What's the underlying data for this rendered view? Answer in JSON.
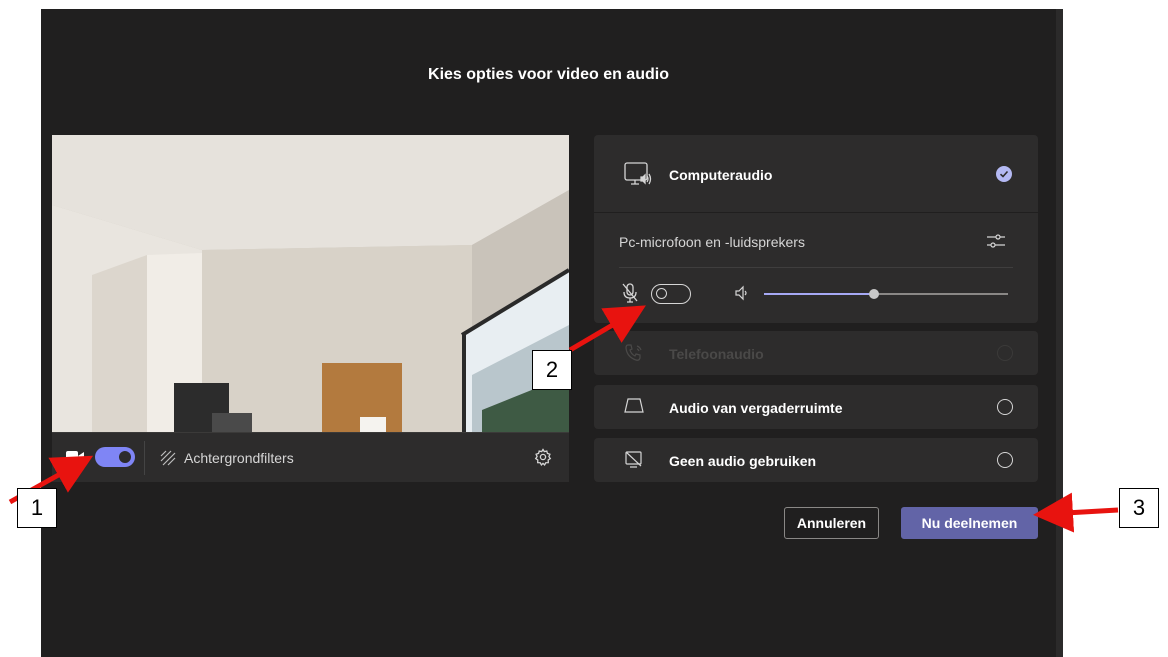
{
  "dialog": {
    "title": "Kies opties voor video en audio"
  },
  "video": {
    "camera_on": true,
    "background_filters_label": "Achtergrondfilters"
  },
  "audio": {
    "computer_audio": {
      "label": "Computeraudio",
      "selected": true,
      "device_label": "Pc-microfoon en -luidsprekers",
      "mic_on": false,
      "volume_fraction": 0.45
    },
    "options": [
      {
        "label": "Telefoonaudio",
        "disabled": true,
        "icon": "phone-audio-icon"
      },
      {
        "label": "Audio van vergaderruimte",
        "disabled": false,
        "icon": "room-audio-icon"
      },
      {
        "label": "Geen audio gebruiken",
        "disabled": false,
        "icon": "no-audio-icon"
      }
    ]
  },
  "buttons": {
    "cancel": "Annuleren",
    "join": "Nu deelnemen"
  },
  "annotations": {
    "callout_1": "1",
    "callout_2": "2",
    "callout_3": "3"
  },
  "colors": {
    "accent": "#6264a7",
    "toggle_on": "#7f85f5",
    "annotation_arrow": "#e8130f"
  }
}
